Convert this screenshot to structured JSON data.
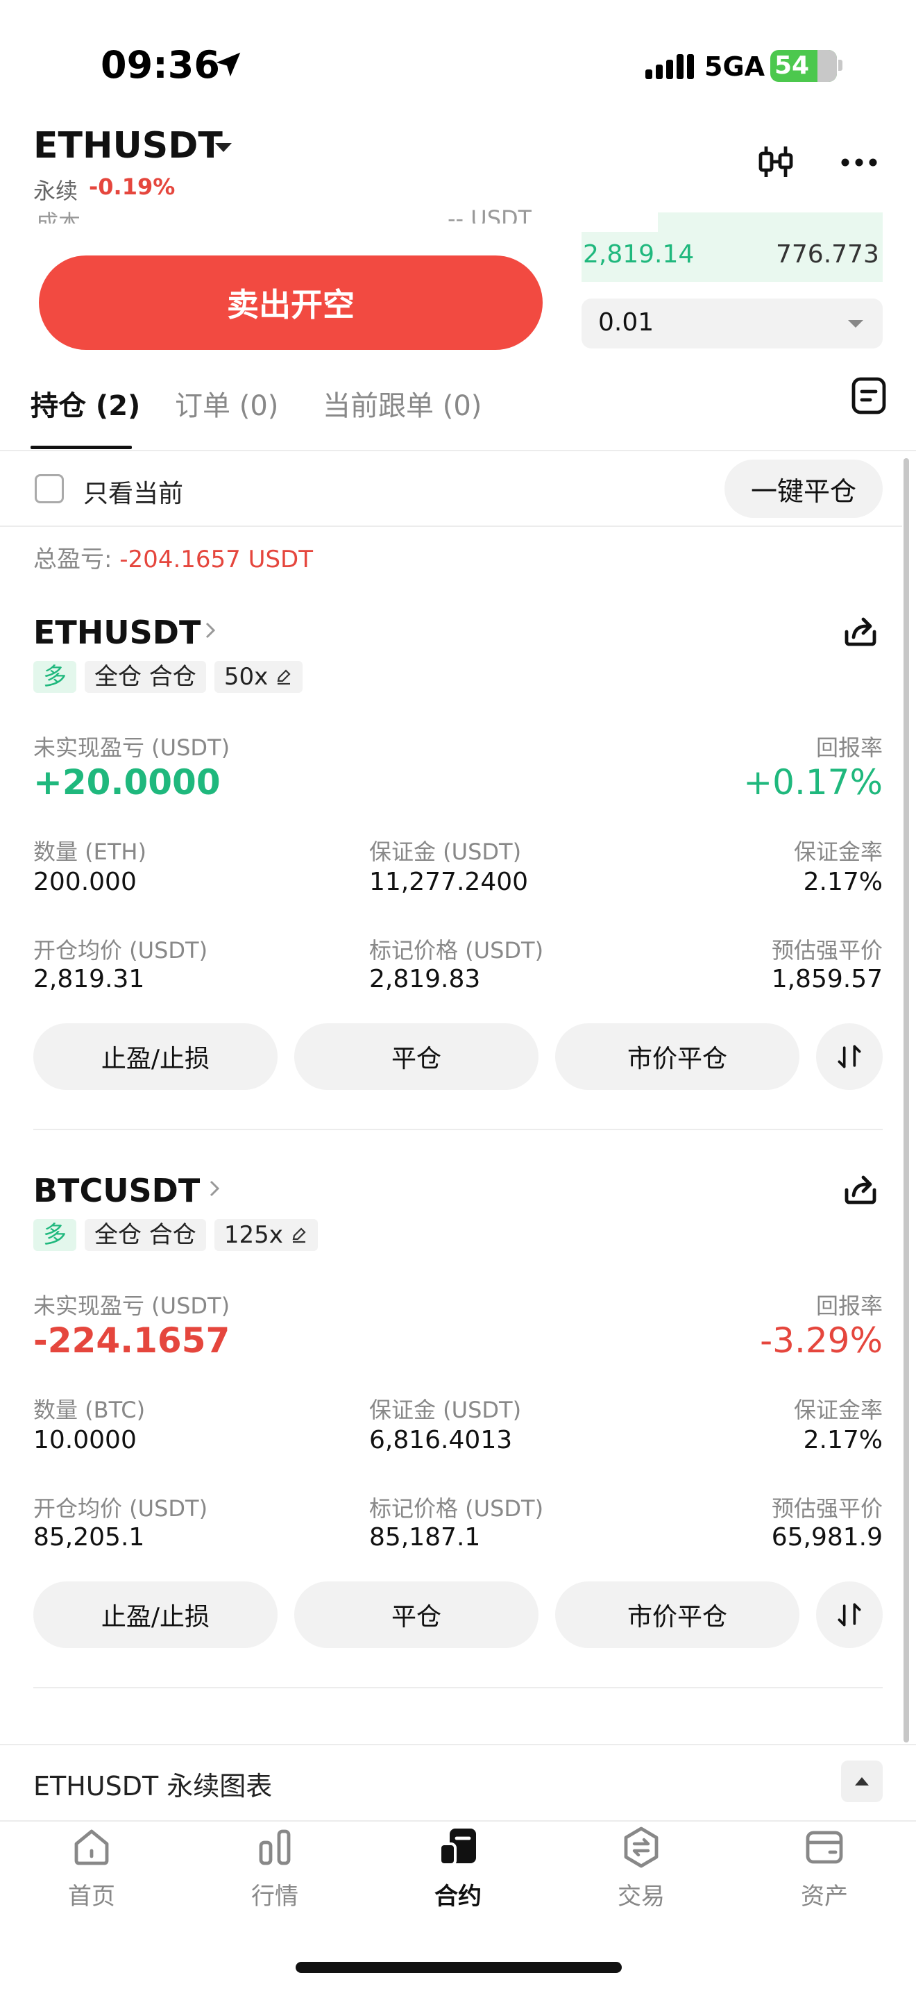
{
  "status_bar": {
    "time": "09:36",
    "network": "5GA",
    "battery": "54"
  },
  "header": {
    "pair": "ETHUSDT",
    "type": "永续",
    "change": "-0.19%"
  },
  "order_form_cut": {
    "label": "成本",
    "value": "-- USDT"
  },
  "order_book": {
    "price": "2,819.14",
    "qty": "776.773"
  },
  "sell_button": "卖出开空",
  "qty_select": "0.01",
  "tabs": [
    "持仓 (2)",
    "订单 (0)",
    "当前跟单 (0)"
  ],
  "filter": {
    "label": "只看当前",
    "close_all": "一键平仓"
  },
  "total_pnl": {
    "label": "总盈亏:",
    "value": "-204.1657 USDT"
  },
  "positions": [
    {
      "symbol": "ETHUSDT",
      "side": "多",
      "margin_mode": "全仓 合仓",
      "leverage": "50x",
      "pnl_label": "未实现盈亏 (USDT)",
      "pnl": "+20.0000",
      "roe_label": "回报率",
      "roe": "+0.17%",
      "qty_label": "数量 (ETH)",
      "qty": "200.000",
      "margin_label": "保证金 (USDT)",
      "margin": "11,277.2400",
      "margin_rate_label": "保证金率",
      "margin_rate": "2.17%",
      "entry_label": "开仓均价 (USDT)",
      "entry": "2,819.31",
      "mark_label": "标记价格 (USDT)",
      "mark": "2,819.83",
      "liq_label": "预估强平价",
      "liq": "1,859.57",
      "btn_tpsl": "止盈/止损",
      "btn_close": "平仓",
      "btn_market_close": "市价平仓"
    },
    {
      "symbol": "BTCUSDT",
      "side": "多",
      "margin_mode": "全仓 合仓",
      "leverage": "125x",
      "pnl_label": "未实现盈亏 (USDT)",
      "pnl": "-224.1657",
      "roe_label": "回报率",
      "roe": "-3.29%",
      "qty_label": "数量 (BTC)",
      "qty": "10.0000",
      "margin_label": "保证金 (USDT)",
      "margin": "6,816.4013",
      "margin_rate_label": "保证金率",
      "margin_rate": "2.17%",
      "entry_label": "开仓均价 (USDT)",
      "entry": "85,205.1",
      "mark_label": "标记价格 (USDT)",
      "mark": "85,187.1",
      "liq_label": "预估强平价",
      "liq": "65,981.9",
      "btn_tpsl": "止盈/止损",
      "btn_close": "平仓",
      "btn_market_close": "市价平仓"
    }
  ],
  "chart_bar": {
    "label": "ETHUSDT 永续图表"
  },
  "nav": [
    "首页",
    "行情",
    "合约",
    "交易",
    "资产"
  ],
  "colors": {
    "up": "#1fb87d",
    "down": "#e5463d",
    "sell": "#f24a41"
  }
}
